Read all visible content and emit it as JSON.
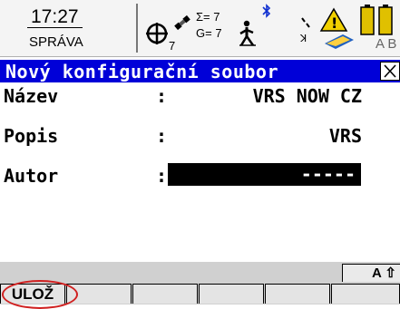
{
  "status": {
    "time": "17:27",
    "mode": "SPRÁVA",
    "sats_glonass_left": "7",
    "sats_sum": "Σ= 7",
    "sats_g": "G= 7",
    "letters": "A B"
  },
  "window": {
    "title": "Nový konfigurační soubor",
    "close_label": "X"
  },
  "fields": [
    {
      "label": "Název",
      "colon": ":",
      "value": "VRS NOW CZ"
    },
    {
      "label": "Popis",
      "colon": ":",
      "value": "VRS"
    },
    {
      "label": "Autor",
      "colon": ":",
      "value": "-----"
    }
  ],
  "footer": {
    "caps_indicator": "A ⇧",
    "f1_label": "ULOŽ",
    "f2_label": "",
    "f3_label": "",
    "f4_label": "",
    "f5_label": "",
    "f6_label": ""
  },
  "colors": {
    "title_bg": "#0000d8",
    "highlight_circle": "#d02020"
  }
}
